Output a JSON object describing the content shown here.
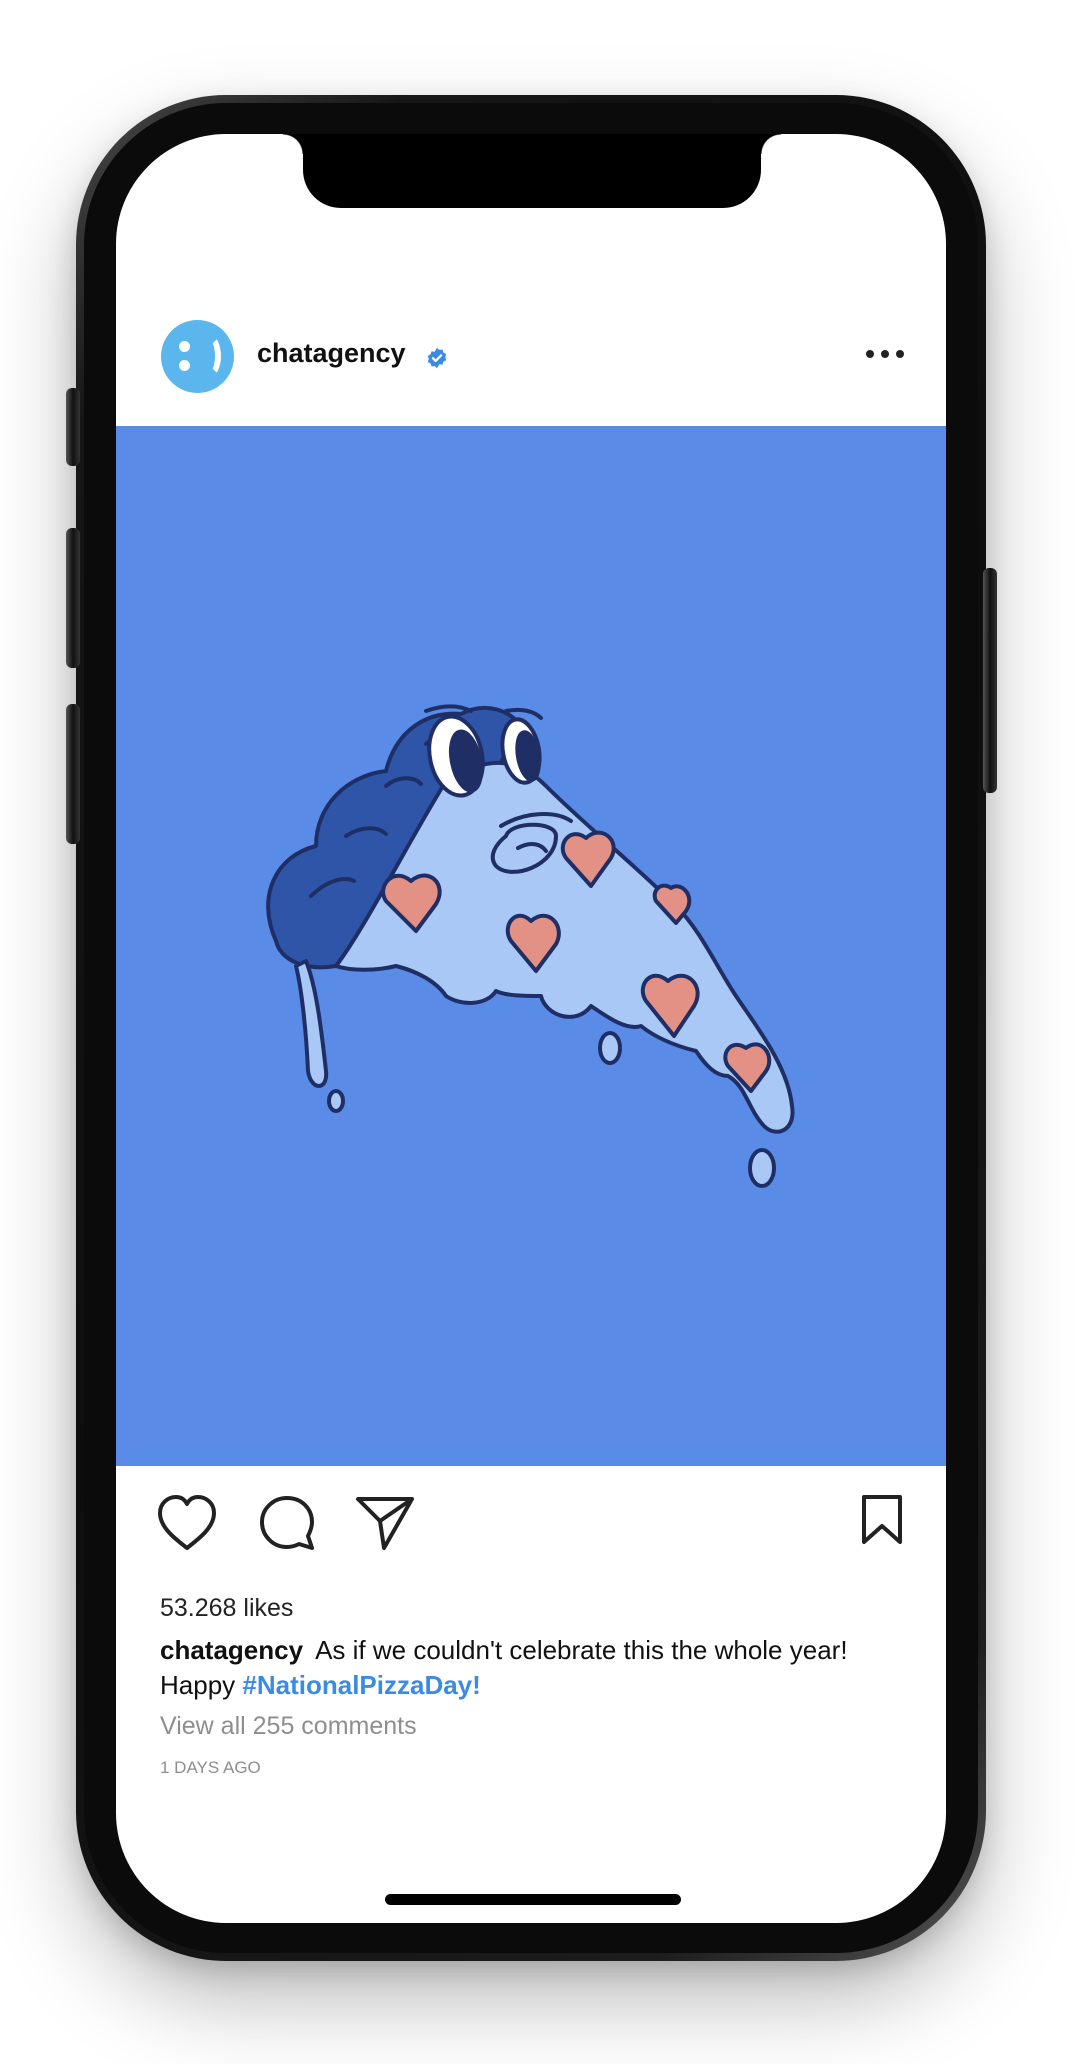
{
  "post": {
    "username": "chatagency",
    "verified": true,
    "avatar_glyph": ":)",
    "image_description_icon": "pizza-slice-illustration",
    "image_background": "#5a8be6",
    "likes": "53.268 likes",
    "caption_user": "chatagency",
    "caption_text": "As if we couldn't celebrate this the whole year!",
    "caption_text_2": "Happy ",
    "hashtag": "#NationalPizzaDay!",
    "view_comments": "View all 255 comments",
    "timestamp": "1 DAYS AGO"
  },
  "colors": {
    "avatar": "#5ab6ec",
    "verified_badge": "#3b8be6",
    "hashtag": "#3b8be6",
    "image_bg": "#5a8be6"
  },
  "icons": [
    "more-icon",
    "heart-icon",
    "comment-icon",
    "share-icon",
    "bookmark-icon",
    "verified-icon"
  ]
}
